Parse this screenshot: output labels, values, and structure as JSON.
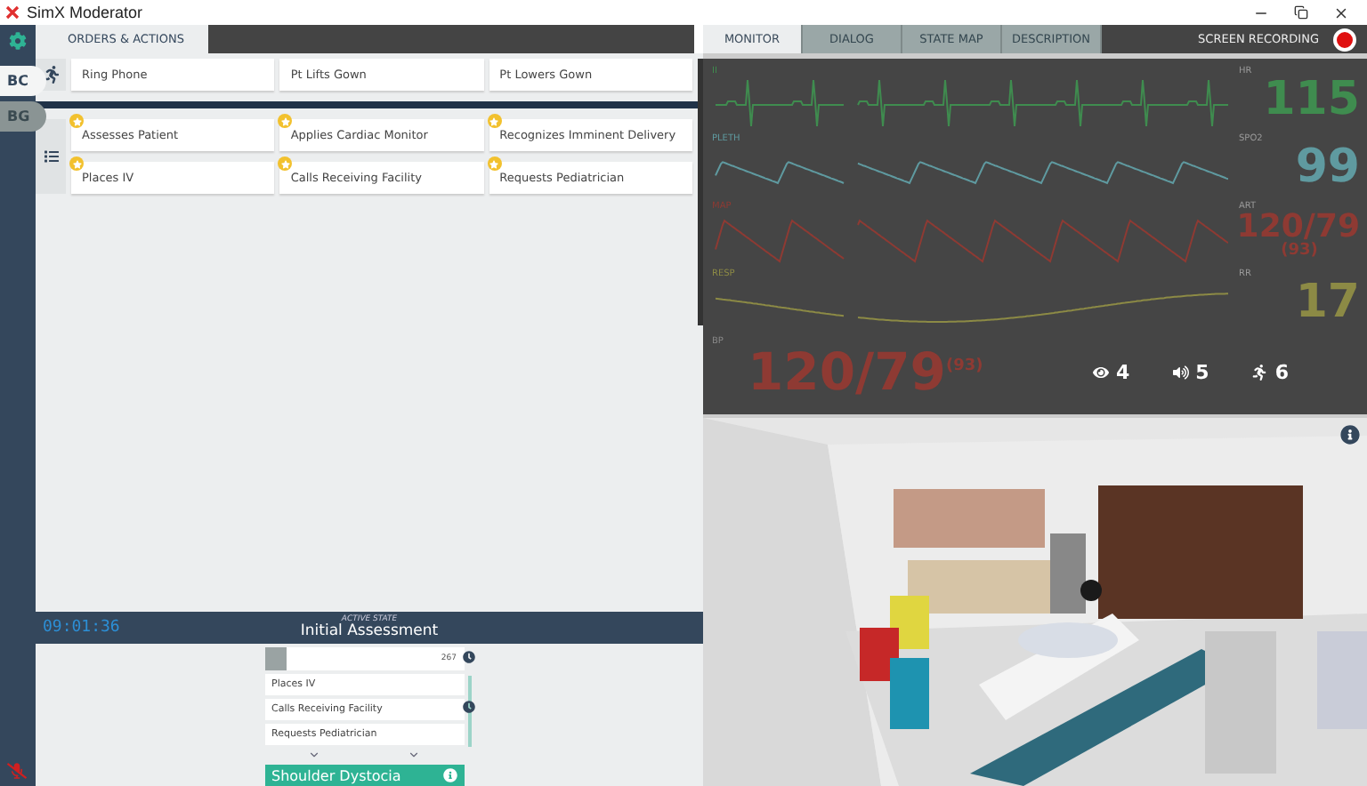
{
  "window": {
    "title": "SimX Moderator"
  },
  "sidebar": {
    "tabs": [
      {
        "label": "BC",
        "selected": true
      },
      {
        "label": "BG",
        "selected": false
      }
    ]
  },
  "left_tabs": [
    {
      "label": "ORDERS & ACTIONS",
      "selected": true
    }
  ],
  "action_groups": [
    {
      "kind": "actions",
      "items": [
        {
          "label": "Ring Phone",
          "starred": false
        },
        {
          "label": "Pt Lifts Gown",
          "starred": false
        },
        {
          "label": "Pt Lowers Gown",
          "starred": false
        }
      ]
    },
    {
      "kind": "orders",
      "items": [
        {
          "label": "Assesses Patient",
          "starred": true
        },
        {
          "label": "Applies Cardiac Monitor",
          "starred": true
        },
        {
          "label": "Recognizes Imminent Delivery",
          "starred": true
        },
        {
          "label": "Places IV",
          "starred": true
        },
        {
          "label": "Calls Receiving Facility",
          "starred": true
        },
        {
          "label": "Requests Pediatrician",
          "starred": true
        }
      ]
    }
  ],
  "state_bar": {
    "timer": "09:01:36",
    "caption": "ACTIVE STATE",
    "state": "Initial Assessment"
  },
  "state_list": {
    "header_count": "267",
    "items": [
      "Places IV",
      "Calls Receiving Facility",
      "Requests Pediatrician"
    ],
    "next_state": "Shoulder Dystocia"
  },
  "right_tabs": [
    {
      "label": "MONITOR",
      "selected": true
    },
    {
      "label": "DIALOG",
      "selected": false
    },
    {
      "label": "STATE MAP",
      "selected": false
    },
    {
      "label": "DESCRIPTION",
      "selected": false
    }
  ],
  "recording": {
    "label": "SCREEN RECORDING",
    "on": true
  },
  "monitor": {
    "waves": [
      {
        "label": "II",
        "kind": "ecg",
        "color": "#3f8c4f"
      },
      {
        "label": "PLETH",
        "kind": "pleth",
        "color": "#5f9aa0"
      },
      {
        "label": "MAP",
        "kind": "art",
        "color": "#8e3a33"
      },
      {
        "label": "RESP",
        "kind": "resp",
        "color": "#8c8a45"
      }
    ],
    "vitals": [
      {
        "label": "HR",
        "value": "115",
        "color": "#3f8c4f"
      },
      {
        "label": "SPO2",
        "value": "99",
        "color": "#5f9aa0"
      },
      {
        "label": "ART",
        "value": "120/79",
        "sub": "(93)",
        "color": "#8e3a33"
      },
      {
        "label": "RR",
        "value": "17",
        "color": "#8c8a45"
      }
    ],
    "bp": {
      "label": "BP",
      "value": "120/79",
      "sub": "(93)",
      "color": "#8e3a33"
    },
    "counters": [
      {
        "kind": "views",
        "value": "4"
      },
      {
        "kind": "sound",
        "value": "5"
      },
      {
        "kind": "actions",
        "value": "6"
      }
    ]
  }
}
